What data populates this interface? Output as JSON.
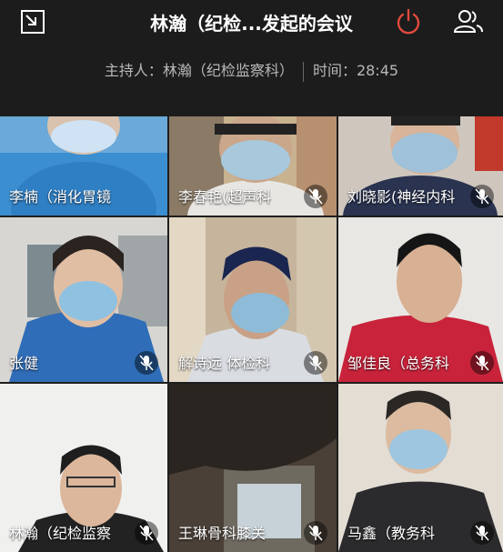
{
  "meeting": {
    "title": "林瀚（纪检...发起的会议",
    "host_label": "主持人：林瀚（纪检监察科）",
    "time_label": "时间：28:45"
  },
  "icons": {
    "shrink": "shrink-window-icon",
    "leave": "power-icon",
    "participants": "participants-icon",
    "mic_muted": "mic-muted-icon"
  },
  "colors": {
    "leave": "#e04a3c",
    "tile_bg": "#1e1e1e"
  },
  "participants": [
    {
      "name": "李楠（消化胃镜"
    },
    {
      "name": "李春艳(超声科"
    },
    {
      "name": "刘晓影(神经内科"
    },
    {
      "name": "张健"
    },
    {
      "name": "解诗远 体检科"
    },
    {
      "name": "邹佳良（总务科"
    },
    {
      "name": "林瀚（纪检监察"
    },
    {
      "name": "王琳骨科膝关"
    },
    {
      "name": "马鑫（教务科"
    }
  ]
}
